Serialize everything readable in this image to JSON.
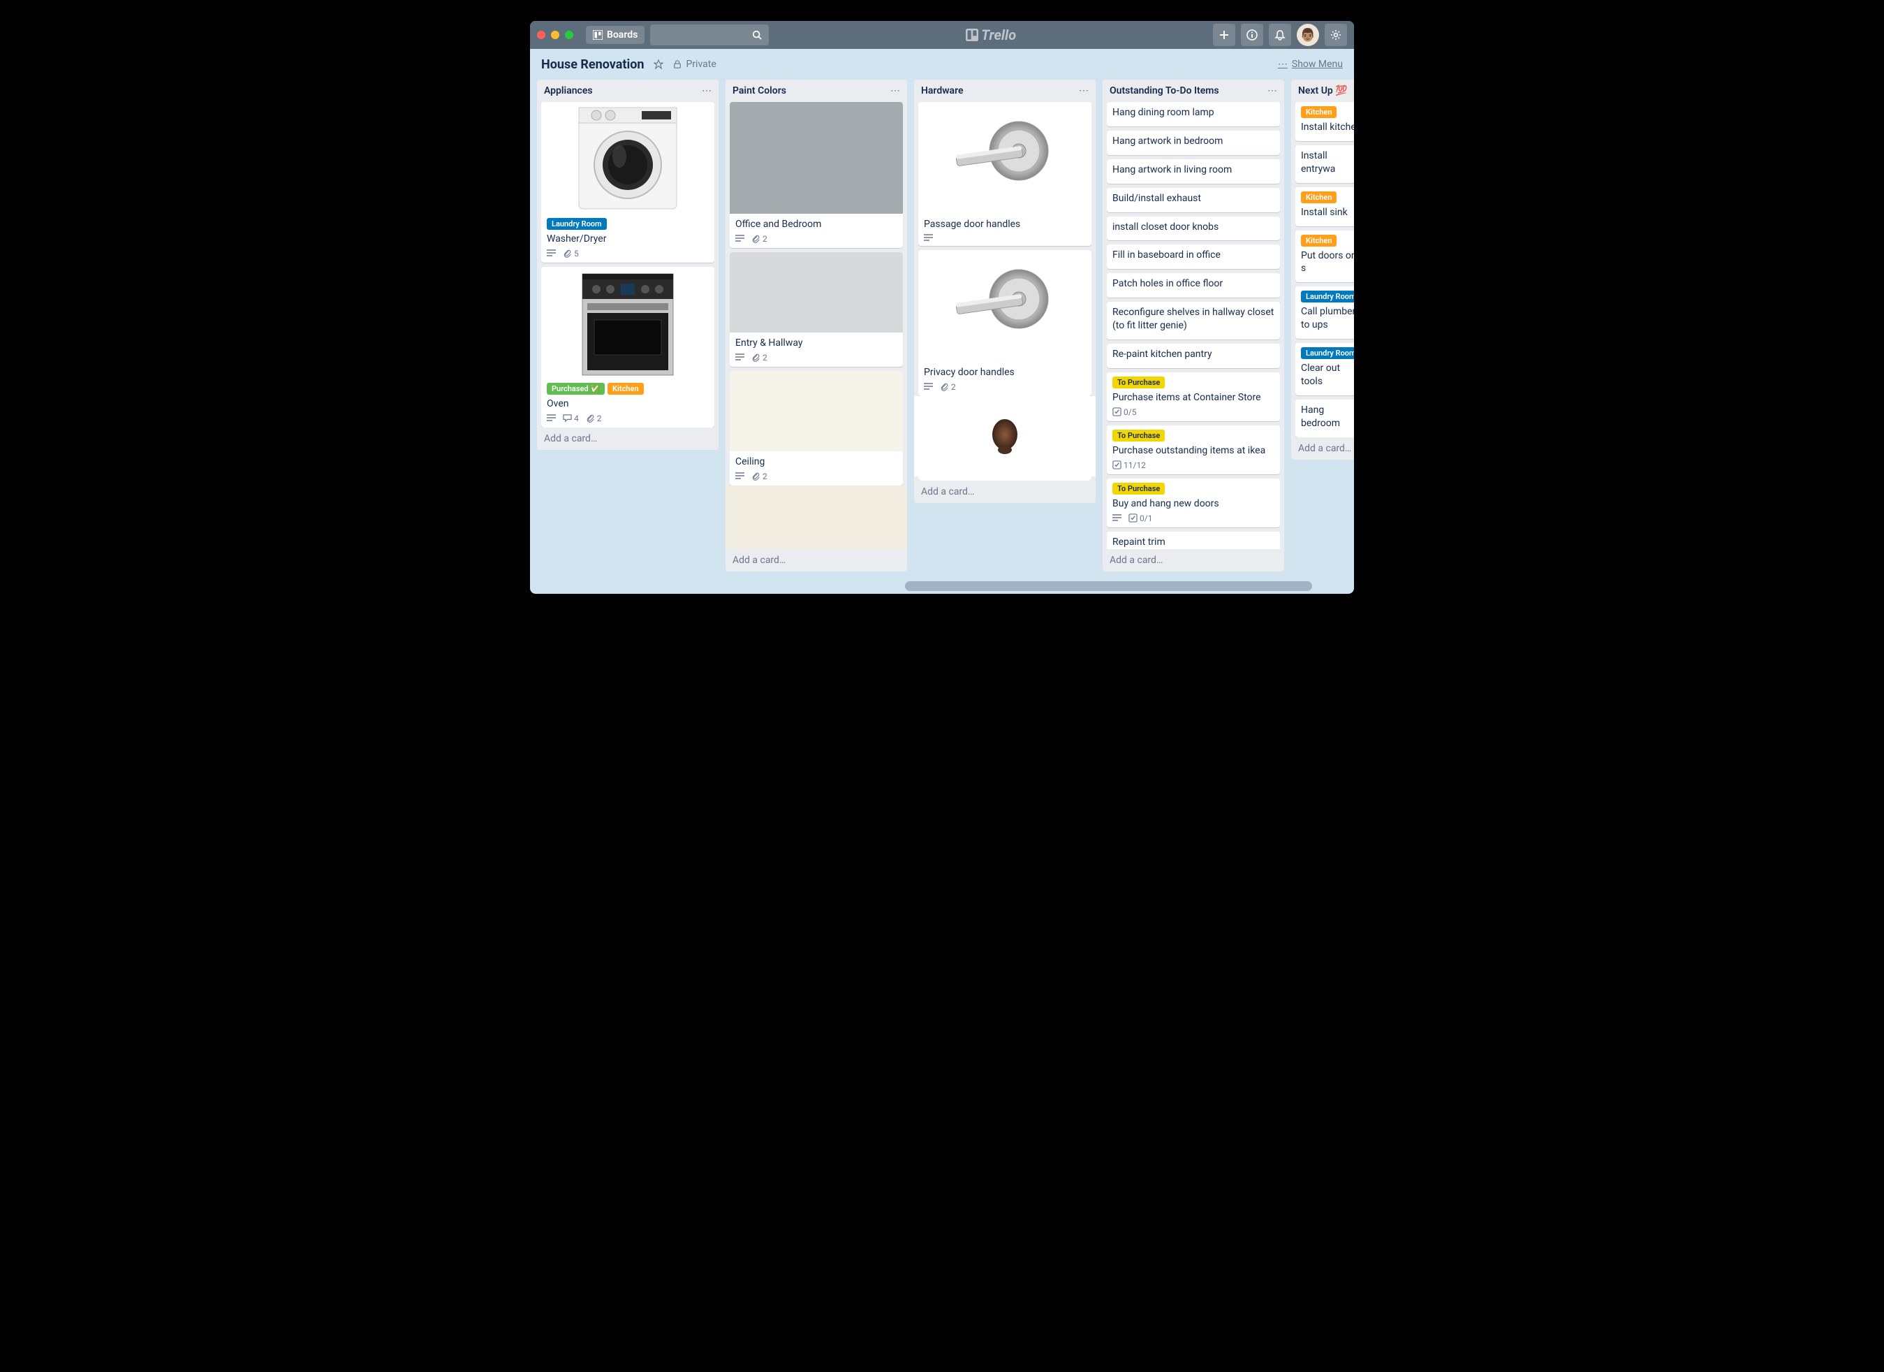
{
  "header": {
    "boards_label": "Boards",
    "logo_text": "Trello"
  },
  "board_header": {
    "title": "House Renovation",
    "privacy": "Private",
    "show_menu": "Show Menu"
  },
  "label_colors": {
    "Laundry Room": "#0079bf",
    "Purchased ✅": "#61bd4f",
    "Kitchen": "#ff9f1a",
    "To Purchase": "#f2d600"
  },
  "lists": [
    {
      "title": "Appliances",
      "add_card": "Add a card…",
      "cards": [
        {
          "title": "Washer/Dryer",
          "cover": "washer",
          "labels": [
            "Laundry Room"
          ],
          "desc": true,
          "attachments": 5
        },
        {
          "title": "Oven",
          "cover": "oven",
          "labels": [
            "Purchased ✅",
            "Kitchen"
          ],
          "desc": true,
          "comments": 4,
          "attachments": 2
        }
      ]
    },
    {
      "title": "Paint Colors",
      "add_card": "Add a card…",
      "cards": [
        {
          "title": "Office and Bedroom",
          "cover_color": "#a3abaf",
          "desc": true,
          "attachments": 2
        },
        {
          "title": "Entry & Hallway",
          "cover_color": "#d8d9da",
          "cover_small": true,
          "desc": true,
          "attachments": 2
        },
        {
          "title": "Ceiling",
          "cover_color": "#f5f3ea",
          "cover_small": true,
          "desc": true,
          "attachments": 2
        },
        {
          "title": "",
          "cover_color": "#f0ece0",
          "cover_small": true,
          "cover_only": true
        }
      ]
    },
    {
      "title": "Hardware",
      "add_card": "Add a card…",
      "cards": [
        {
          "title": "Passage door handles",
          "cover": "handle",
          "desc": true
        },
        {
          "title": "Privacy door handles",
          "cover": "handle",
          "desc": true,
          "attachments": 2
        },
        {
          "title": "",
          "cover": "knob",
          "cover_only": true,
          "cover_small": true
        }
      ]
    },
    {
      "title": "Outstanding To-Do Items",
      "add_card": "Add a card…",
      "cards": [
        {
          "title": "Hang dining room lamp"
        },
        {
          "title": "Hang artwork in bedroom"
        },
        {
          "title": "Hang artwork in living room"
        },
        {
          "title": "Build/install exhaust"
        },
        {
          "title": "install closet door knobs"
        },
        {
          "title": "Fill in baseboard in office"
        },
        {
          "title": "Patch holes in office floor"
        },
        {
          "title": "Reconfigure shelves in hallway closet (to fit litter genie)"
        },
        {
          "title": "Re-paint kitchen pantry"
        },
        {
          "title": "Purchase items at Container Store",
          "labels": [
            "To Purchase"
          ],
          "checklist": "0/5"
        },
        {
          "title": "Purchase outstanding items at ikea",
          "labels": [
            "To Purchase"
          ],
          "checklist": "11/12"
        },
        {
          "title": "Buy and hang new doors",
          "labels": [
            "To Purchase"
          ],
          "desc": true,
          "checklist": "0/1"
        },
        {
          "title": "Repaint trim"
        }
      ]
    },
    {
      "title": "Next Up 💯",
      "add_card": "Add a card…",
      "cards": [
        {
          "title": "Install kitchen",
          "labels": [
            "Kitchen"
          ]
        },
        {
          "title": "Install entrywa"
        },
        {
          "title": "Install sink",
          "labels": [
            "Kitchen"
          ]
        },
        {
          "title": "Put doors on s",
          "labels": [
            "Kitchen"
          ]
        },
        {
          "title": "Call plumber to ups",
          "labels": [
            "Laundry Room"
          ]
        },
        {
          "title": "Clear out tools",
          "labels": [
            "Laundry Room"
          ]
        },
        {
          "title": "Hang bedroom"
        }
      ]
    }
  ]
}
